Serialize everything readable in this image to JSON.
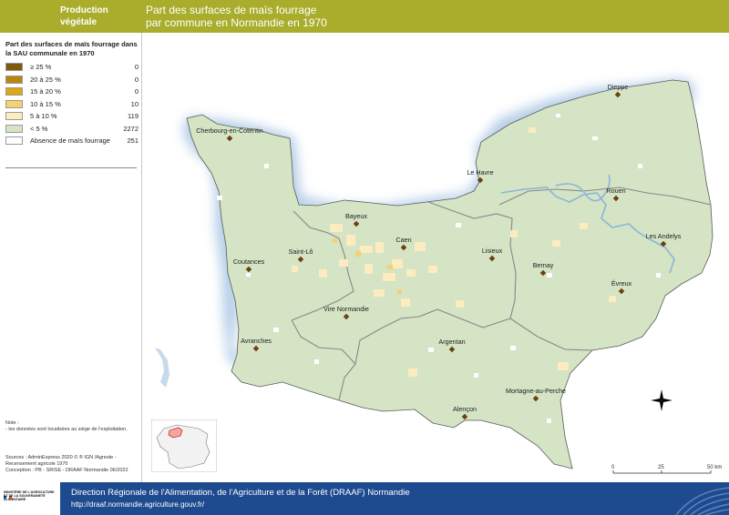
{
  "header": {
    "theme": "Production végétale",
    "title_line1": "Part des surfaces de maïs fourrage",
    "title_line2": "par commune en Normandie en 1970"
  },
  "legend": {
    "title": "Part des surfaces de maïs fourrage dans la SAU communale en 1970",
    "items": [
      {
        "label": "≥ 25 %",
        "count": "0",
        "color": "#7d5a10"
      },
      {
        "label": "20 à 25 %",
        "count": "0",
        "color": "#b7860f"
      },
      {
        "label": "15 à 20 %",
        "count": "0",
        "color": "#e0a613"
      },
      {
        "label": "10 à 15 %",
        "count": "10",
        "color": "#f7d072"
      },
      {
        "label": "5 à 10 %",
        "count": "119",
        "color": "#fcecc0"
      },
      {
        "label": "< 5 %",
        "count": "2272",
        "color": "#d4e4c4"
      },
      {
        "label": "Absence de maïs fourrage",
        "count": "251",
        "color": "#ffffff"
      }
    ]
  },
  "note": {
    "title": "Note :",
    "text": "- les données sont localisées au siège de l'exploitation."
  },
  "sources": {
    "line1": "Sources      : AdminExpress 2020 © ® IGN /Agreste -",
    "line2": "Recensement agricole 1970",
    "line3": "Conception : PB - SRISE - DRAAF Normandie 06/2022"
  },
  "map": {
    "cities": [
      "Dieppe",
      "Cherbourg-en-Cotentin",
      "Le Havre",
      "Rouen",
      "Bayeux",
      "Caen",
      "Les Andelys",
      "Saint-Lô",
      "Lisieux",
      "Coutances",
      "Bernay",
      "Évreux",
      "Vire Normandie",
      "Avranches",
      "Argentan",
      "Mortagne-au-Perche",
      "Alençon"
    ],
    "scale": {
      "labels": [
        "0",
        "25",
        "50 km"
      ]
    }
  },
  "footer": {
    "line1": "Direction Régionale de l'Alimentation, de l'Agriculture et de la Forêt (DRAAF) Normandie",
    "line2": "http://draaf.normandie.agriculture.gouv.fr/",
    "logo_text": "MINISTÈRE DE L'AGRICULTURE ET DE LA SOUVERAINETÉ ALIMENTAIRE"
  },
  "colors": {
    "header": "#a9ad2b",
    "footer": "#1e4a8f",
    "sea": "#a9c6e4",
    "land": "#d4e4c4"
  }
}
